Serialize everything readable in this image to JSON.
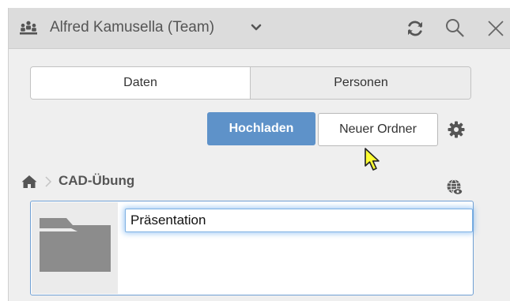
{
  "header": {
    "team_icon": "team-icon",
    "title": "Alfred Kamusella (Team)",
    "dropdown_icon": "chevron-down-icon",
    "refresh_icon": "refresh-icon",
    "search_icon": "search-icon",
    "close_icon": "close-icon"
  },
  "tabs": [
    {
      "label": "Daten",
      "active": true
    },
    {
      "label": "Personen",
      "active": false
    }
  ],
  "toolbar": {
    "upload_label": "Hochladen",
    "new_folder_label": "Neuer Ordner",
    "settings_icon": "gear-icon"
  },
  "breadcrumb": {
    "home_icon": "home-icon",
    "separator_icon": "chevron-right-icon",
    "current": "CAD-Übung",
    "visibility_icon": "globe-eye-icon"
  },
  "new_folder": {
    "icon": "folder-icon",
    "name_value": "Präsentation"
  },
  "colors": {
    "header_bg": "#dcdcdc",
    "panel_bg": "#efefef",
    "primary_button": "#5e92c9",
    "focus_ring": "#7fb1e3"
  }
}
